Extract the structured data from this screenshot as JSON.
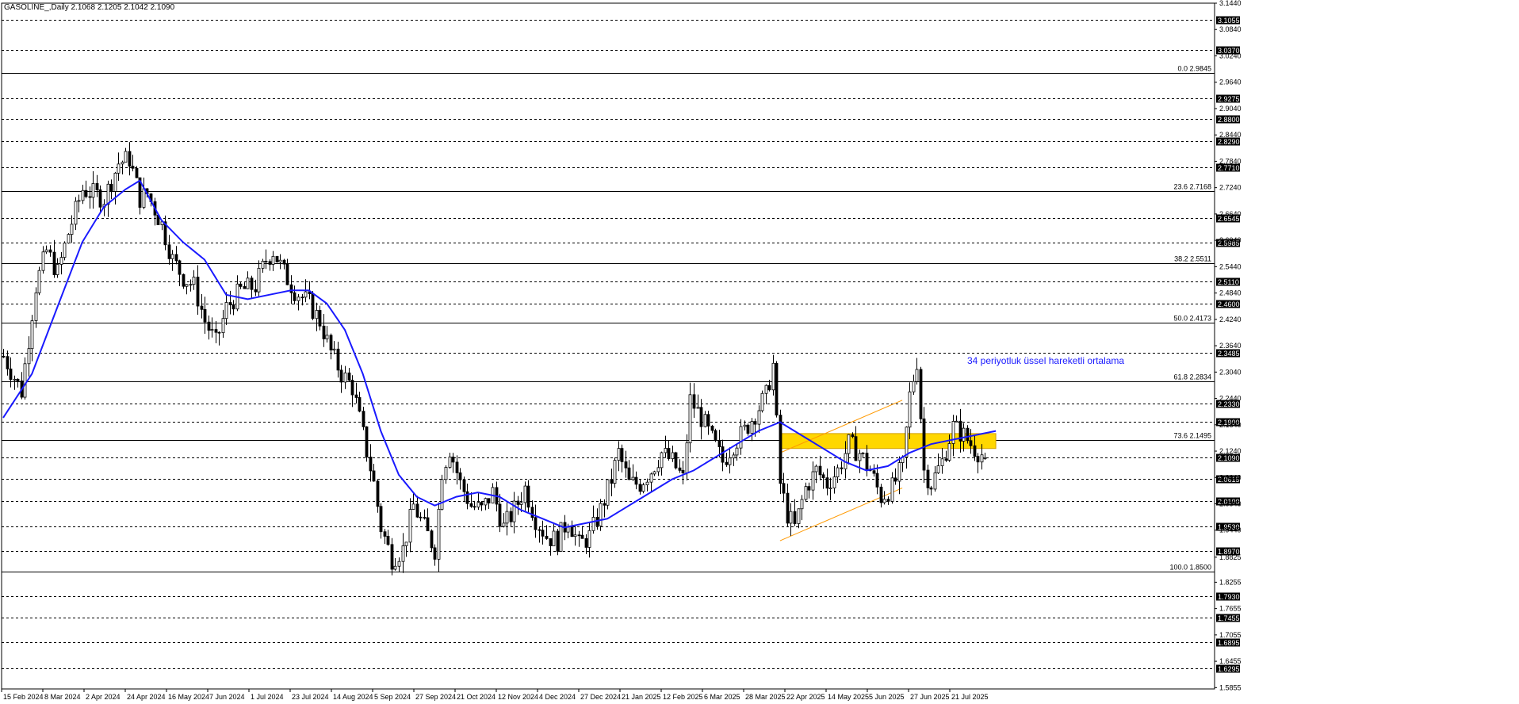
{
  "header": {
    "symbol_text": "GASOLINE_,Daily  2.1068 2.1205 2.1042 2.1090"
  },
  "annotation": {
    "ema_label": "34 periyotluk üssel hareketli ortalama"
  },
  "colors": {
    "background": "#ffffff",
    "candle": "#000000",
    "ema": "#1a1aff",
    "channel": "#ff9900",
    "zone": "#ffd700",
    "zone_border": "#d4a000",
    "level_tag_bg": "#000000",
    "level_tag_text": "#ffffff"
  },
  "chart_data": {
    "type": "candlestick",
    "symbol": "GASOLINE_",
    "timeframe": "Daily",
    "last_ohlc": {
      "open": 2.1068,
      "high": 2.1205,
      "low": 2.1042,
      "close": 2.109
    },
    "y_range": [
      1.5825,
      3.144
    ],
    "price_axis_ticks": [
      "3.1440",
      "3.0840",
      "3.0240",
      "2.9640",
      "2.9040",
      "2.8440",
      "2.7840",
      "2.7240",
      "2.6640",
      "2.6040",
      "2.5440",
      "2.4840",
      "2.4240",
      "2.3640",
      "2.3040",
      "2.2440",
      "2.1840",
      "2.1240",
      "2.0640",
      "2.0040",
      "1.9440",
      "1.8825",
      "1.8255",
      "1.7655",
      "1.7055",
      "1.6455",
      "1.5855"
    ],
    "x_axis_labels": [
      "15 Feb 2024",
      "8 Mar 2024",
      "2 Apr 2024",
      "24 Apr 2024",
      "16 May 2024",
      "7 Jun 2024",
      "1 Jul 2024",
      "23 Jul 2024",
      "14 Aug 2024",
      "5 Sep 2024",
      "27 Sep 2024",
      "21 Oct 2024",
      "12 Nov 2024",
      "4 Dec 2024",
      "27 Dec 2024",
      "21 Jan 2025",
      "12 Feb 2025",
      "6 Mar 2025",
      "28 Mar 2025",
      "22 Apr 2025",
      "14 May 2025",
      "5 Jun 2025",
      "27 Jun 2025",
      "21 Jul 2025"
    ],
    "horizontal_levels": [
      "3.1055",
      "3.0370",
      "2.9275",
      "2.8800",
      "2.8290",
      "2.7710",
      "2.6545",
      "2.5985",
      "2.5110",
      "2.4600",
      "2.3485",
      "2.2330",
      "2.1900",
      "2.1090",
      "2.0615",
      "2.0100",
      "1.9530",
      "1.8970",
      "1.7930",
      "1.7455",
      "1.6895",
      "1.6295"
    ],
    "fibonacci_levels": [
      {
        "label": "0.0 2.9845",
        "value": 2.9845
      },
      {
        "label": "23.6 2.7168",
        "value": 2.7168
      },
      {
        "label": "38.2 2.5511",
        "value": 2.5511
      },
      {
        "label": "50.0 2.4173",
        "value": 2.4173
      },
      {
        "label": "61.8 2.2834",
        "value": 2.2834
      },
      {
        "label": "73.6 2.1495",
        "value": 2.1495
      },
      {
        "label": "100.0 1.8500",
        "value": 1.85
      }
    ],
    "resistance_zone": {
      "from": 2.13,
      "to": 2.164
    },
    "price_path": [
      [
        0,
        2.34
      ],
      [
        5,
        2.26
      ],
      [
        9,
        2.5
      ],
      [
        12,
        2.58
      ],
      [
        15,
        2.53
      ],
      [
        18,
        2.62
      ],
      [
        22,
        2.72
      ],
      [
        25,
        2.71
      ],
      [
        28,
        2.7
      ],
      [
        32,
        2.78
      ],
      [
        35,
        2.79
      ],
      [
        38,
        2.7
      ],
      [
        40,
        2.71
      ],
      [
        44,
        2.64
      ],
      [
        47,
        2.56
      ],
      [
        50,
        2.52
      ],
      [
        53,
        2.5
      ],
      [
        56,
        2.42
      ],
      [
        59,
        2.37
      ],
      [
        62,
        2.45
      ],
      [
        66,
        2.49
      ],
      [
        70,
        2.5
      ],
      [
        73,
        2.56
      ],
      [
        75,
        2.58
      ],
      [
        78,
        2.53
      ],
      [
        81,
        2.49
      ],
      [
        85,
        2.46
      ],
      [
        88,
        2.42
      ],
      [
        91,
        2.35
      ],
      [
        94,
        2.3
      ],
      [
        97,
        2.27
      ],
      [
        100,
        2.16
      ],
      [
        103,
        2.05
      ],
      [
        105,
        1.95
      ],
      [
        108,
        1.88
      ],
      [
        111,
        1.9
      ],
      [
        114,
        2.0
      ],
      [
        117,
        1.95
      ],
      [
        120,
        1.9
      ],
      [
        122,
        2.08
      ],
      [
        124,
        2.13
      ],
      [
        127,
        2.05
      ],
      [
        130,
        2.0
      ],
      [
        133,
        1.99
      ],
      [
        136,
        2.03
      ],
      [
        139,
        1.95
      ],
      [
        142,
        1.99
      ],
      [
        145,
        2.04
      ],
      [
        148,
        1.97
      ],
      [
        151,
        1.93
      ],
      [
        154,
        1.92
      ],
      [
        157,
        1.97
      ],
      [
        160,
        1.91
      ],
      [
        163,
        1.93
      ],
      [
        166,
        1.99
      ],
      [
        169,
        2.06
      ],
      [
        171,
        2.12
      ],
      [
        174,
        2.05
      ],
      [
        177,
        2.05
      ],
      [
        180,
        2.08
      ],
      [
        183,
        2.12
      ],
      [
        186,
        2.1
      ],
      [
        189,
        2.06
      ],
      [
        191,
        2.24
      ],
      [
        194,
        2.2
      ],
      [
        197,
        2.15
      ],
      [
        200,
        2.1
      ],
      [
        203,
        2.14
      ],
      [
        206,
        2.17
      ],
      [
        209,
        2.21
      ],
      [
        212,
        2.25
      ],
      [
        214,
        2.32
      ],
      [
        216,
        2.05
      ],
      [
        218,
        1.98
      ],
      [
        220,
        1.95
      ],
      [
        223,
        2.04
      ],
      [
        226,
        2.08
      ],
      [
        229,
        2.05
      ],
      [
        232,
        2.08
      ],
      [
        235,
        2.14
      ],
      [
        238,
        2.12
      ],
      [
        241,
        2.08
      ],
      [
        244,
        2.02
      ],
      [
        247,
        2.04
      ],
      [
        250,
        2.09
      ],
      [
        252,
        2.25
      ],
      [
        254,
        2.33
      ],
      [
        256,
        2.08
      ],
      [
        258,
        2.05
      ],
      [
        261,
        2.1
      ],
      [
        264,
        2.18
      ],
      [
        267,
        2.16
      ],
      [
        270,
        2.13
      ],
      [
        273,
        2.11
      ]
    ],
    "ema": {
      "label": "34 periyotluk üssel hareketli ortalama",
      "path": [
        [
          0,
          2.2
        ],
        [
          8,
          2.3
        ],
        [
          15,
          2.45
        ],
        [
          22,
          2.6
        ],
        [
          28,
          2.68
        ],
        [
          34,
          2.72
        ],
        [
          38,
          2.74
        ],
        [
          44,
          2.65
        ],
        [
          50,
          2.6
        ],
        [
          56,
          2.56
        ],
        [
          62,
          2.48
        ],
        [
          68,
          2.47
        ],
        [
          74,
          2.48
        ],
        [
          80,
          2.49
        ],
        [
          85,
          2.49
        ],
        [
          90,
          2.46
        ],
        [
          95,
          2.4
        ],
        [
          100,
          2.3
        ],
        [
          105,
          2.17
        ],
        [
          110,
          2.07
        ],
        [
          115,
          2.02
        ],
        [
          120,
          2.0
        ],
        [
          126,
          2.02
        ],
        [
          132,
          2.03
        ],
        [
          138,
          2.02
        ],
        [
          144,
          1.99
        ],
        [
          150,
          1.97
        ],
        [
          156,
          1.95
        ],
        [
          162,
          1.96
        ],
        [
          168,
          1.97
        ],
        [
          174,
          2.0
        ],
        [
          180,
          2.03
        ],
        [
          186,
          2.06
        ],
        [
          192,
          2.08
        ],
        [
          198,
          2.11
        ],
        [
          204,
          2.14
        ],
        [
          210,
          2.17
        ],
        [
          216,
          2.19
        ],
        [
          222,
          2.16
        ],
        [
          228,
          2.13
        ],
        [
          234,
          2.1
        ],
        [
          240,
          2.08
        ],
        [
          246,
          2.09
        ],
        [
          252,
          2.12
        ],
        [
          258,
          2.14
        ],
        [
          264,
          2.15
        ],
        [
          270,
          2.16
        ],
        [
          276,
          2.17
        ]
      ]
    },
    "channel_lines": [
      {
        "from": [
          216,
          1.92
        ],
        "to": [
          250,
          2.04
        ]
      },
      {
        "from": [
          216,
          2.12
        ],
        "to": [
          250,
          2.24
        ]
      }
    ]
  }
}
